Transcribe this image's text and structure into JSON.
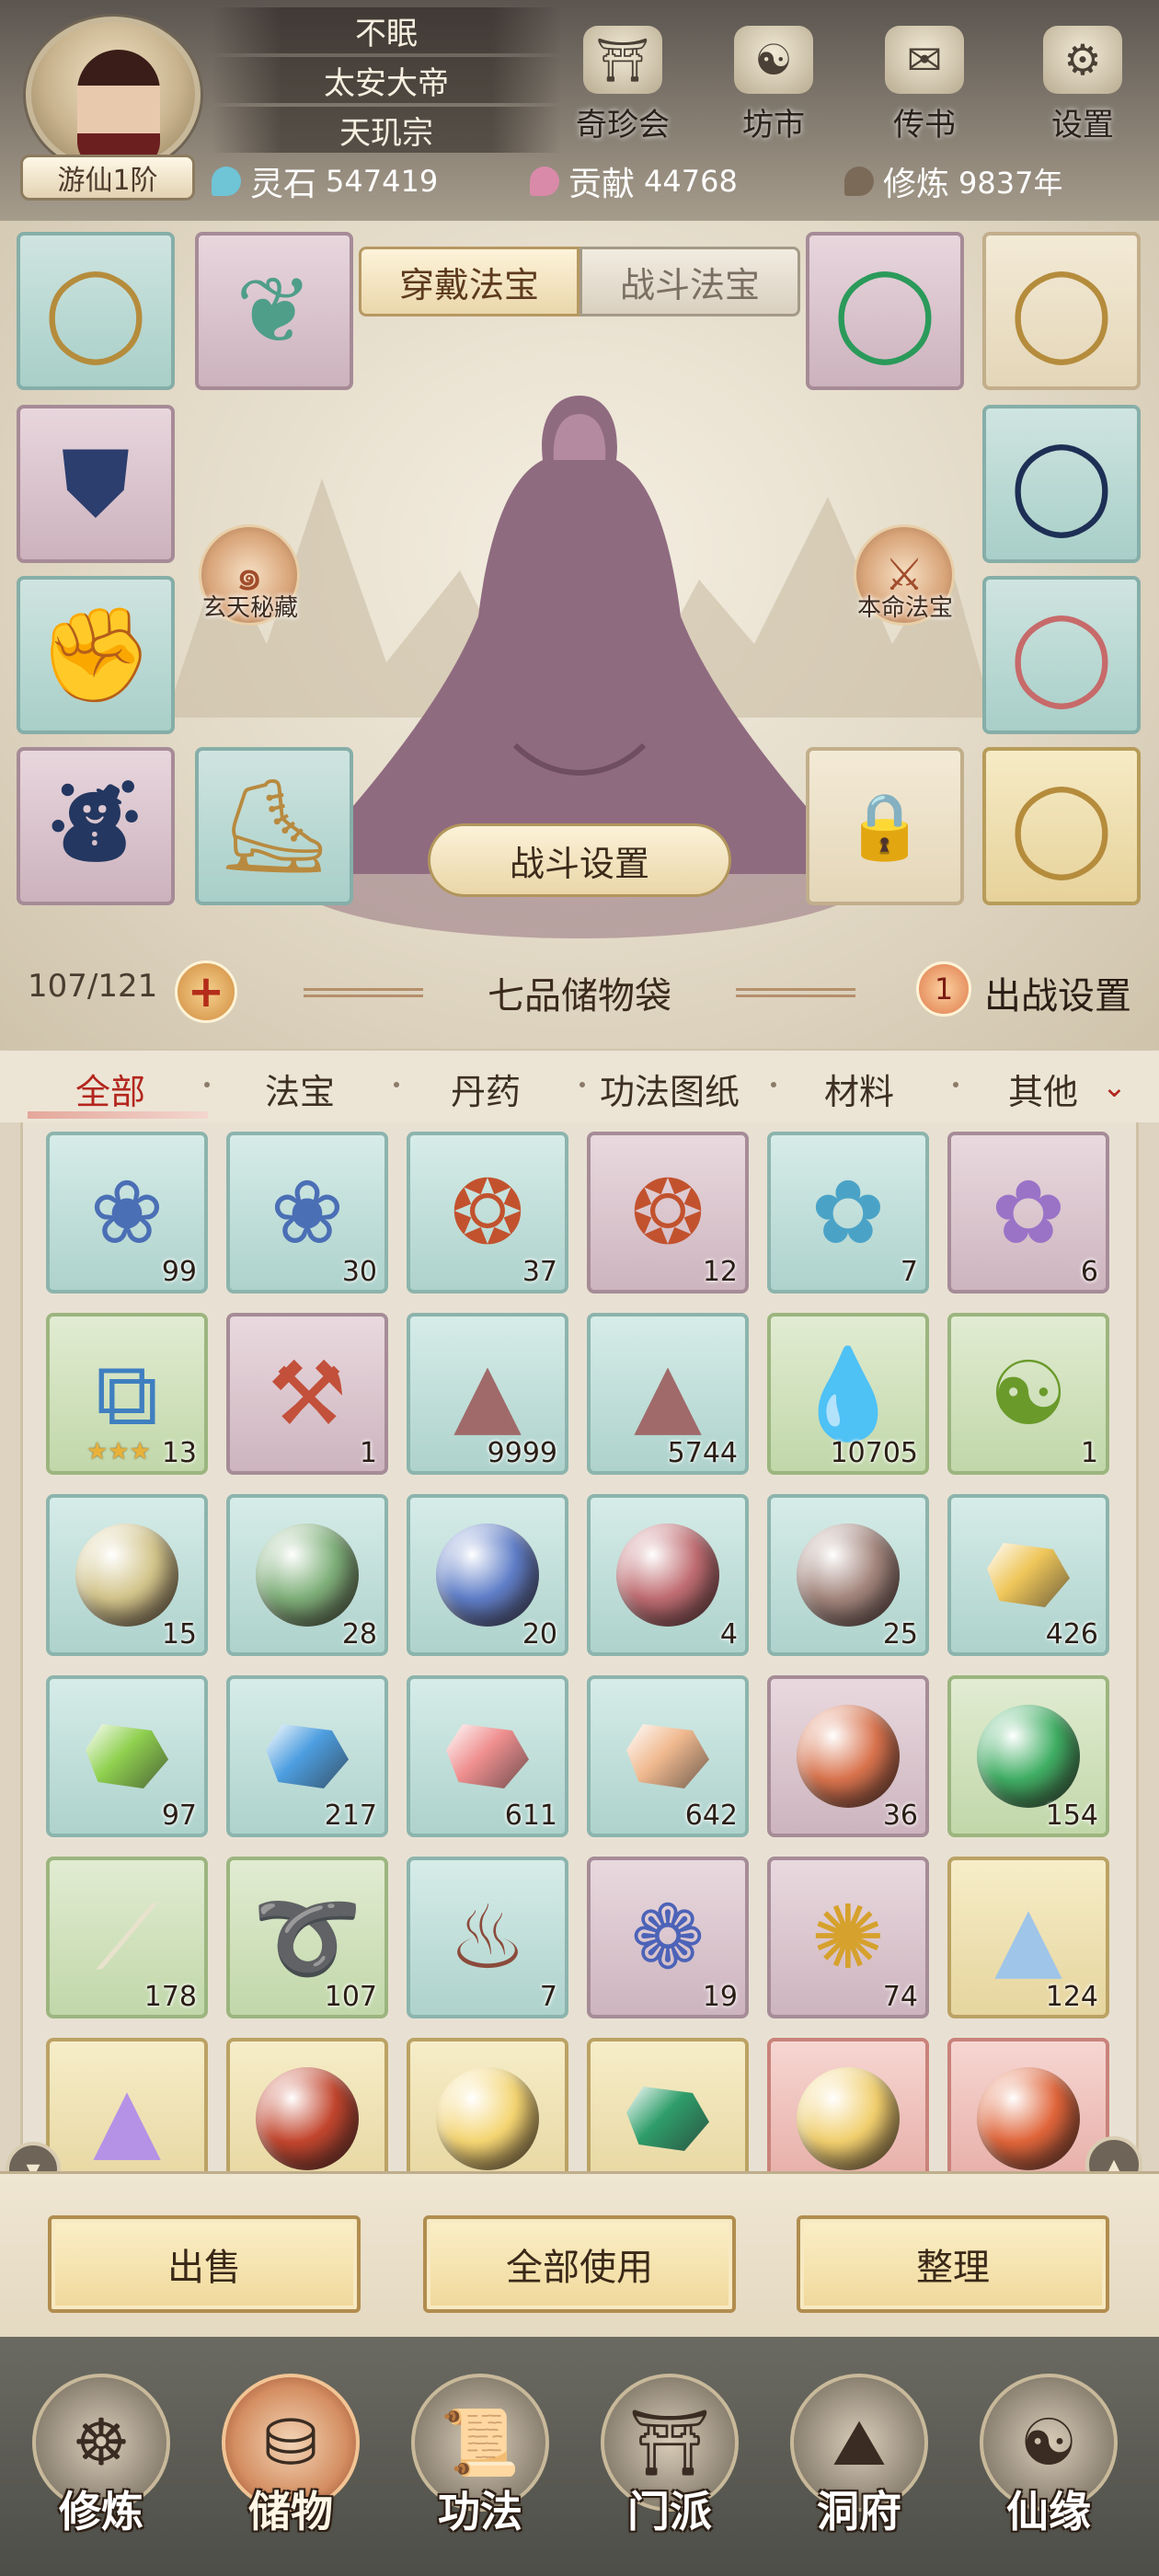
{
  "profile": {
    "names": [
      "不眠",
      "太安大帝",
      "天玑宗"
    ],
    "rank": "游仙1阶"
  },
  "top_buttons": [
    {
      "label": "奇珍会",
      "icon": "treasure-pavilion-icon"
    },
    {
      "label": "坊市",
      "icon": "market-icon"
    },
    {
      "label": "传书",
      "icon": "scroll-letter-icon"
    },
    {
      "label": "设置",
      "icon": "gear-icon"
    }
  ],
  "resources": [
    {
      "label": "灵石",
      "value": "547419",
      "color": "#6fc4d6"
    },
    {
      "label": "贡献",
      "value": "44768",
      "color": "#d98aa8"
    },
    {
      "label": "修炼",
      "value": "9837年",
      "color": "#7b6a58"
    }
  ],
  "equip_tabs": {
    "wear": "穿戴法宝",
    "battle": "战斗法宝"
  },
  "side_badges": {
    "left": "玄天秘藏",
    "right": "本命法宝"
  },
  "battle_setting": "战斗设置",
  "bag": {
    "count": "107/121",
    "title": "七品储物袋",
    "deploy_count": "1",
    "deploy_label": "出战设置"
  },
  "categories": [
    "全部",
    "法宝",
    "丹药",
    "功法图纸",
    "材料",
    "其他"
  ],
  "items": [
    {
      "icon": "lotus-flower-icon",
      "count": "99",
      "bg": "teal",
      "glyph": "❀",
      "color": "#4b6fb5"
    },
    {
      "icon": "lotus-flower-icon",
      "count": "30",
      "bg": "teal",
      "glyph": "❀",
      "color": "#4b6fb5"
    },
    {
      "icon": "spiky-fruit-icon",
      "count": "37",
      "bg": "teal",
      "glyph": "❂",
      "color": "#c2522e"
    },
    {
      "icon": "spiky-fruit-icon",
      "count": "12",
      "bg": "violet",
      "glyph": "❂",
      "color": "#c2522e"
    },
    {
      "icon": "crystal-shell-icon",
      "count": "7",
      "bg": "teal",
      "glyph": "✿",
      "color": "#4aa3c7"
    },
    {
      "icon": "crystal-shell-icon",
      "count": "6",
      "bg": "violet",
      "glyph": "✿",
      "color": "#9a73c7"
    },
    {
      "icon": "scroll-map-icon",
      "count": "13",
      "bg": "green",
      "glyph": "⧉",
      "color": "#3f7fc0",
      "stars": "★★★"
    },
    {
      "icon": "axe-icon",
      "count": "1",
      "bg": "violet",
      "glyph": "⚒",
      "color": "#c2503b"
    },
    {
      "icon": "sand-pile-icon",
      "count": "9999",
      "bg": "teal",
      "glyph": "▲",
      "color": "#a06a6a"
    },
    {
      "icon": "sand-pile-icon",
      "count": "5744",
      "bg": "teal",
      "glyph": "▲",
      "color": "#a06a6a"
    },
    {
      "icon": "water-drop-icon",
      "count": "10705",
      "bg": "green",
      "glyph": "💧",
      "color": "#5aa6d6"
    },
    {
      "icon": "jade-bowl-icon",
      "count": "1",
      "bg": "green",
      "glyph": "☯",
      "color": "#6a9a2a"
    },
    {
      "icon": "yellow-orb-icon",
      "count": "15",
      "bg": "teal",
      "orb": "#d2c48a"
    },
    {
      "icon": "green-orb-icon",
      "count": "28",
      "bg": "teal",
      "orb": "#7fb07a"
    },
    {
      "icon": "blue-orb-icon",
      "count": "20",
      "bg": "teal",
      "orb": "#5f7ec8"
    },
    {
      "icon": "red-orb-icon",
      "count": "4",
      "bg": "teal",
      "orb": "#c06d72"
    },
    {
      "icon": "brown-orb-icon",
      "count": "25",
      "bg": "teal",
      "orb": "#a4877e"
    },
    {
      "icon": "gold-crystal-icon",
      "count": "426",
      "bg": "teal",
      "shard": "#efc65a"
    },
    {
      "icon": "green-crystal-icon",
      "count": "97",
      "bg": "teal",
      "shard": "#8fd04f"
    },
    {
      "icon": "blue-crystal-icon",
      "count": "217",
      "bg": "teal",
      "shard": "#4d9ee0"
    },
    {
      "icon": "pink-crystal-icon",
      "count": "611",
      "bg": "teal",
      "shard": "#ef8f8f"
    },
    {
      "icon": "peach-crystal-icon",
      "count": "642",
      "bg": "teal",
      "shard": "#f0b98f"
    },
    {
      "icon": "red-swirl-orb-icon",
      "count": "36",
      "bg": "violet",
      "orb": "#d9734d"
    },
    {
      "icon": "jade-orb-icon",
      "count": "154",
      "bg": "green",
      "orb": "#3fae63"
    },
    {
      "icon": "bone-icon",
      "count": "178",
      "bg": "green",
      "glyph": "⟋",
      "color": "#e8e2cc"
    },
    {
      "icon": "rope-icon",
      "count": "107",
      "bg": "green",
      "glyph": "➰",
      "color": "#9e6f5a"
    },
    {
      "icon": "gourd-icon",
      "count": "7",
      "bg": "teal",
      "glyph": "♨",
      "color": "#8b4a3b"
    },
    {
      "icon": "blue-berries-icon",
      "count": "19",
      "bg": "violet",
      "glyph": "❁",
      "color": "#4c63b8"
    },
    {
      "icon": "golden-herb-icon",
      "count": "74",
      "bg": "violet",
      "glyph": "✺",
      "color": "#d6a12c"
    },
    {
      "icon": "blue-dust-icon",
      "count": "124",
      "bg": "gold",
      "glyph": "▲",
      "color": "#9fc5e8"
    },
    {
      "icon": "purple-dust-icon",
      "count": "",
      "bg": "gold",
      "glyph": "▲",
      "color": "#b592e6"
    },
    {
      "icon": "crimson-orb-icon",
      "count": "",
      "bg": "gold",
      "orb": "#c2452d"
    },
    {
      "icon": "sun-orb-icon",
      "count": "",
      "bg": "gold",
      "orb": "#f4d572"
    },
    {
      "icon": "emerald-shard-icon",
      "count": "",
      "bg": "gold",
      "shard": "#2e9d6a"
    },
    {
      "icon": "golden-egg-icon",
      "count": "",
      "bg": "red",
      "orb": "#f1cf6e"
    },
    {
      "icon": "fire-egg-icon",
      "count": "",
      "bg": "red",
      "orb": "#e0653a"
    }
  ],
  "actions": [
    "出售",
    "全部使用",
    "整理"
  ],
  "nav": [
    {
      "label": "修炼",
      "icon": "meditating-sage-icon",
      "glyph": "☸"
    },
    {
      "label": "储物",
      "icon": "storage-bag-icon",
      "glyph": "⛁",
      "active": true
    },
    {
      "label": "功法",
      "icon": "technique-scroll-icon",
      "glyph": "📜"
    },
    {
      "label": "门派",
      "icon": "sect-gate-icon",
      "glyph": "⛩"
    },
    {
      "label": "洞府",
      "icon": "cave-mountain-icon",
      "glyph": "⛰"
    },
    {
      "label": "仙缘",
      "icon": "immortal-fate-icon",
      "glyph": "☯"
    }
  ],
  "equip_slots": {
    "left": [
      {
        "icon": "golden-necklace-icon",
        "bg": "teal",
        "glyph": "◯",
        "color": "#b58c3c"
      },
      {
        "icon": "armor-icon",
        "bg": "violet",
        "glyph": "⛊",
        "color": "#2c3e6e"
      },
      {
        "icon": "gauntlet-icon",
        "bg": "teal",
        "glyph": "✊",
        "color": "#b8833e"
      },
      {
        "icon": "pants-icon",
        "bg": "violet",
        "glyph": "⛇",
        "color": "#233760"
      }
    ],
    "inner_left": [
      {
        "icon": "fish-pendant-icon",
        "bg": "violet",
        "glyph": "❦",
        "color": "#4f9e8a"
      },
      {
        "icon": "boots-icon",
        "bg": "teal",
        "glyph": "⛸",
        "color": "#b88a3f"
      }
    ],
    "right": [
      {
        "icon": "gold-ring-icon",
        "bg": "cream",
        "glyph": "◯",
        "color": "#b58c3c"
      },
      {
        "icon": "sapphire-ring-icon",
        "bg": "teal",
        "glyph": "◯",
        "color": "#1e2f55"
      },
      {
        "icon": "ruby-ring-icon",
        "bg": "teal",
        "glyph": "◯",
        "color": "#c76a6a"
      },
      {
        "icon": "gold-ring-icon",
        "bg": "gold",
        "glyph": "◯",
        "color": "#b58c3c"
      }
    ],
    "inner_right": [
      {
        "icon": "jade-ring-icon",
        "bg": "violet",
        "glyph": "◯",
        "color": "#2a9a5a"
      },
      {
        "icon": "lock-icon",
        "bg": "cream",
        "glyph": "🔒",
        "color": "#b68c50"
      }
    ]
  }
}
